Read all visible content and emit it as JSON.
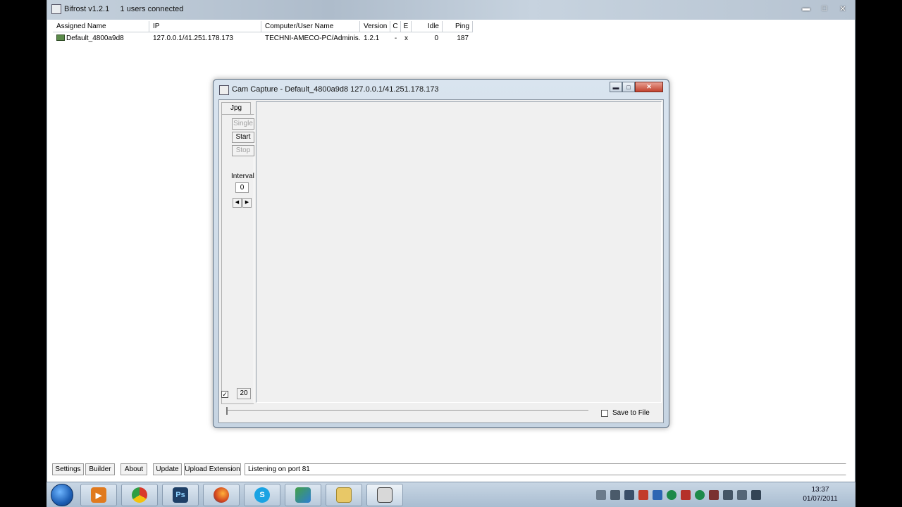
{
  "main_window": {
    "title": "Bifrost v1.2.1     1 users connected",
    "controls": {
      "minimize": "▬",
      "maximize": "□",
      "close": "✕"
    }
  },
  "list": {
    "columns": [
      "Assigned Name",
      "IP",
      "Computer/User Name",
      "Version",
      "C",
      "E",
      "Idle",
      "Ping"
    ],
    "rows": [
      {
        "assigned_name": "Default_4800a9d8",
        "ip": "127.0.0.1/41.251.178.173",
        "computer_user": "TECHNI-AMECO-PC/Adminis...",
        "version": "1.2.1",
        "c": "-",
        "e": "x",
        "idle": "0",
        "ping": "187"
      }
    ]
  },
  "bottom_buttons": {
    "settings": "Settings",
    "builder": "Builder",
    "about": "About",
    "update": "Update",
    "upload_extension": "Upload Extension"
  },
  "status": "Listening on port 81",
  "cam_capture": {
    "title": "Cam Capture - Default_4800a9d8 127.0.0.1/41.251.178.173",
    "tab": "Jpg",
    "single": "Single",
    "start": "Start",
    "stop": "Stop",
    "interval_label": "Interval",
    "interval_value": "0",
    "spin_left": "◀",
    "spin_right": "▶",
    "checkbox_mark": "✓",
    "quality_value": "20",
    "save_to_file": "Save to File",
    "controls": {
      "minimize": "▬",
      "maximize": "□",
      "close": "✕"
    }
  },
  "taskbar": {
    "items": [
      "media-player",
      "chrome",
      "photoshop",
      "firefox",
      "skype",
      "messenger",
      "file-explorer",
      "bifrost"
    ],
    "photoshop_label": "Ps",
    "skype_label": "S",
    "clock_time": "13:37",
    "clock_date": "01/07/2011"
  }
}
